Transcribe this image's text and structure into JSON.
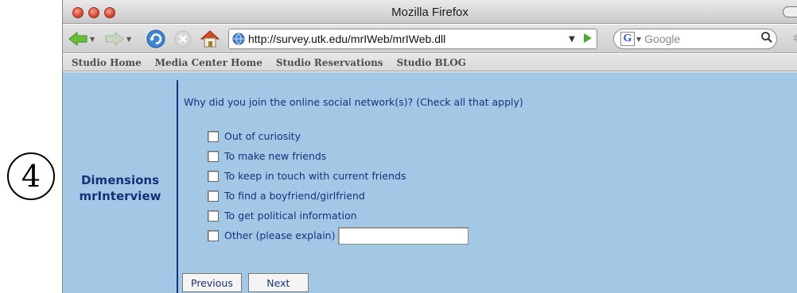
{
  "step_marker": "4",
  "window": {
    "title": "Mozilla Firefox"
  },
  "toolbar": {
    "url": "http://survey.utk.edu/mrIWeb/mrIWeb.dll",
    "search_placeholder": "Google",
    "search_engine_letter": "G"
  },
  "bookmarks": [
    "Studio Home",
    "Media Center Home",
    "Studio Reservations",
    "Studio BLOG"
  ],
  "brand": {
    "line1": "Dimensions",
    "line2": "mrInterview"
  },
  "survey": {
    "question": "Why did you join the online social network(s)? (Check all that apply)",
    "options": [
      "Out of curiosity",
      "To make new friends",
      "To keep in touch with current friends",
      "To find a boyfriend/girlfriend",
      "To get political information",
      "Other (please explain)"
    ],
    "other_value": ""
  },
  "buttons": {
    "previous": "Previous",
    "next": "Next"
  },
  "colors": {
    "page_bg": "#a3c8e6",
    "text": "#1a2f7a"
  }
}
